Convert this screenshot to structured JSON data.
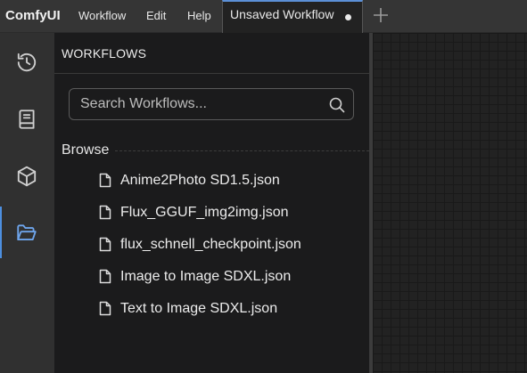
{
  "app": {
    "name": "ComfyUI",
    "menu": [
      "Workflow",
      "Edit",
      "Help"
    ],
    "active_tab": {
      "label": "Unsaved Workflow",
      "unsaved": true
    },
    "new_tab_icon": "plus-icon"
  },
  "sidebar_rail": [
    {
      "icon": "history-icon",
      "active": false
    },
    {
      "icon": "model-library-icon",
      "active": false
    },
    {
      "icon": "node-library-cube-icon",
      "active": false
    },
    {
      "icon": "workflows-folder-open-icon",
      "active": true
    }
  ],
  "workflows_panel": {
    "title": "WORKFLOWS",
    "search": {
      "placeholder": "Search Workflows...",
      "value": ""
    },
    "browse_label": "Browse",
    "files": [
      "Anime2Photo SD1.5.json",
      "Flux_GGUF_img2img.json",
      "flux_schnell_checkpoint.json",
      "Image to Image SDXL.json",
      "Text to Image SDXL.json"
    ]
  },
  "colors": {
    "accent": "#4d8fe0",
    "topbar": "#353535",
    "rail": "#303030",
    "panel": "#1b1b1c",
    "canvas": "#222222"
  }
}
